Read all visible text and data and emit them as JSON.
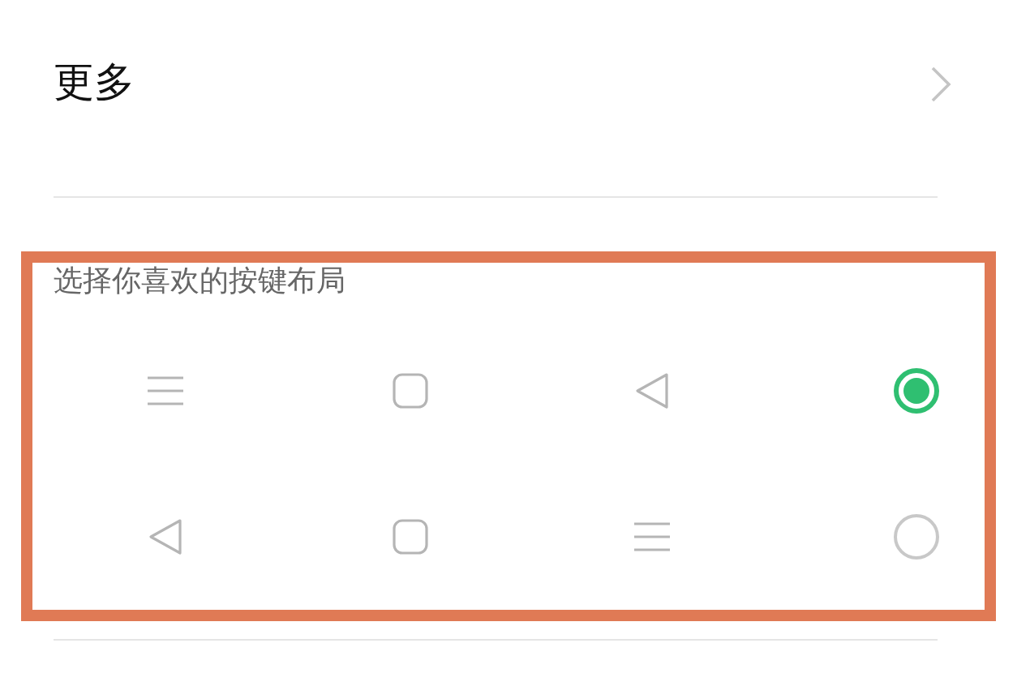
{
  "more_item": {
    "label": "更多"
  },
  "layout_section": {
    "title": "选择你喜欢的按键布局",
    "options": [
      {
        "keys": [
          {
            "kind": "menu"
          },
          {
            "kind": "home"
          },
          {
            "kind": "back"
          }
        ],
        "selected": true
      },
      {
        "keys": [
          {
            "kind": "back"
          },
          {
            "kind": "home"
          },
          {
            "kind": "menu"
          }
        ],
        "selected": false
      }
    ]
  }
}
